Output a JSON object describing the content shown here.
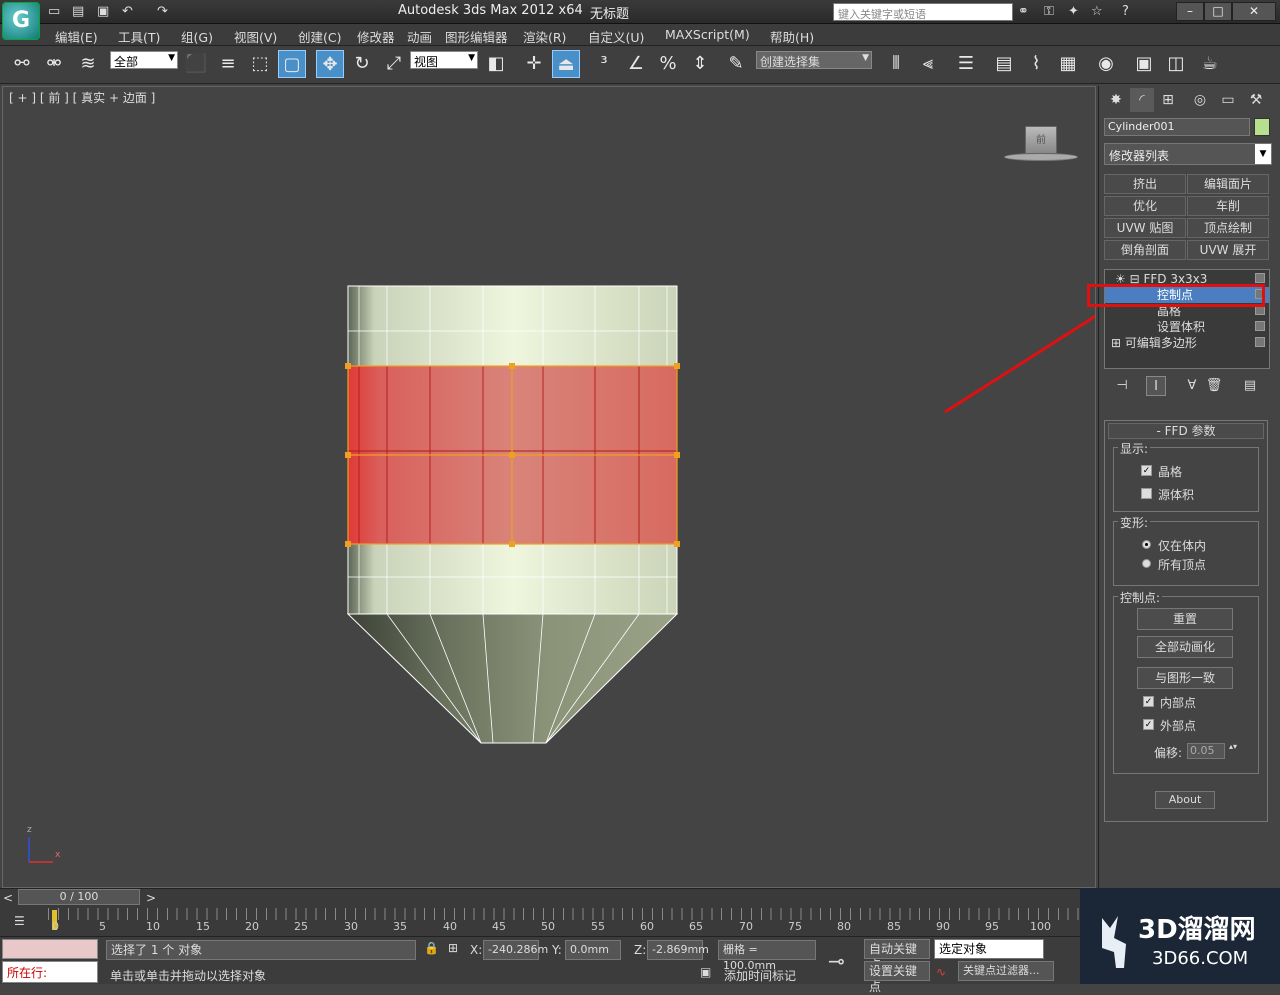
{
  "app": {
    "title": "Autodesk 3ds Max  2012 x64",
    "document": "无标题",
    "search_placeholder": "键入关键字或短语",
    "logo": "G"
  },
  "menu": [
    "编辑(E)",
    "工具(T)",
    "组(G)",
    "视图(V)",
    "创建(C)",
    "修改器",
    "动画",
    "图形编辑器",
    "渲染(R)",
    "自定义(U)",
    "MAXScript(M)",
    "帮助(H)"
  ],
  "toolbar": {
    "filter_select": "全部",
    "coord_select": "视图",
    "named_selection": "创建选择集"
  },
  "viewport": {
    "label": "[ + ] [ 前 ] [ 真实 + 边面 ]",
    "viewcube_text": "前",
    "axis_z": "z",
    "axis_x": "x"
  },
  "command_panel": {
    "object_name": "Cylinder001",
    "object_color": "#b6e08e",
    "modifier_list": "修改器列表",
    "modifier_buttons": [
      "挤出",
      "编辑面片",
      "优化",
      "车削",
      "UVW 贴图",
      "顶点绘制",
      "倒角剖面",
      "UVW 展开"
    ],
    "stack": [
      "FFD 3x3x3",
      "控制点",
      "晶格",
      "设置体积",
      "可编辑多边形"
    ],
    "rollout_title": "FFD 参数",
    "display_label": "显示:",
    "lattice_label": "晶格",
    "source_volume_label": "源体积",
    "deform_label": "变形:",
    "only_in_volume": "仅在体内",
    "all_vertices": "所有顶点",
    "control_points_label": "控制点:",
    "reset_button": "重置",
    "animate_all_button": "全部动画化",
    "conform_button": "与图形一致",
    "inside_points": "内部点",
    "outside_points": "外部点",
    "offset_label": "偏移:",
    "offset_value": "0.05",
    "about_button": "About"
  },
  "timeline": {
    "slider": "0 / 100",
    "ticks": [
      "0",
      "5",
      "10",
      "15",
      "20",
      "25",
      "30",
      "35",
      "40",
      "45",
      "50",
      "55",
      "60",
      "65",
      "70",
      "75",
      "80",
      "85",
      "90",
      "95",
      "100"
    ]
  },
  "status": {
    "running_label": "所在行:",
    "selected": "选择了 1 个 对象",
    "prompt": "单击或单击并拖动以选择对象",
    "x_label": "X:",
    "x_value": "-240.286m",
    "y_label": "Y:",
    "y_value": "0.0mm",
    "z_label": "Z:",
    "z_value": "-2.869mm",
    "grid": "栅格 = 100.0mm",
    "auto_key": "自动关键点",
    "set_key": "设置关键点",
    "selected_object": "选定对象",
    "key_filter": "关键点过滤器...",
    "add_time_tag": "添加时间标记"
  },
  "colors": {
    "accent": "#4a7ec0",
    "highlight_box": "#e01010",
    "selection_fill": "#d9605c",
    "lattice": "#f0a020"
  }
}
